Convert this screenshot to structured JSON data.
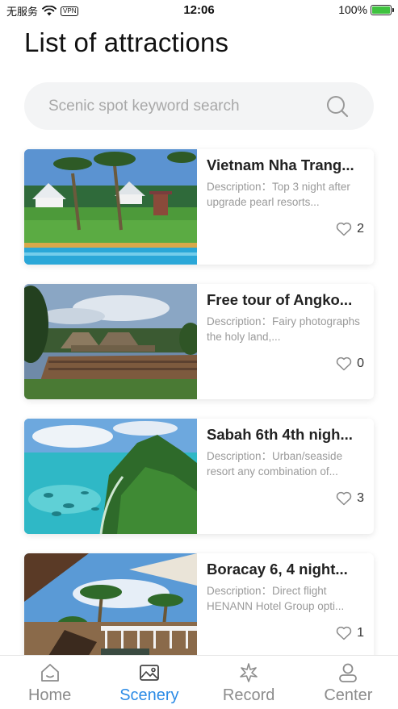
{
  "status_bar": {
    "carrier": "无服务",
    "vpn": "VPN",
    "time": "12:06",
    "battery": "100%",
    "battery_color": "#3fc23f"
  },
  "page": {
    "title": "List of attractions"
  },
  "search": {
    "placeholder": "Scenic spot keyword search",
    "icon": "search-icon"
  },
  "attractions": [
    {
      "title": "Vietnam Nha Trang...",
      "description": "Description：Top 3 night after upgrade pearl resorts...",
      "likes": "2",
      "image": "resort-garden-pool"
    },
    {
      "title": "Free tour of Angko...",
      "description": "Description：Fairy photographs the holy land,...",
      "likes": "0",
      "image": "angkor-temple"
    },
    {
      "title": "Sabah 6th 4th nigh...",
      "description": "Description：Urban/seaside resort any combination of...",
      "likes": "3",
      "image": "tropical-island-bay"
    },
    {
      "title": "Boracay 6, 4 night...",
      "description": "Description：Direct flight HENANN Hotel Group opti...",
      "likes": "1",
      "image": "beach-terrace-palms"
    }
  ],
  "tab_bar": {
    "accent_color": "#2b8be6",
    "inactive_color": "#8c8c8c",
    "tabs": [
      {
        "label": "Home",
        "icon": "home-icon",
        "active": false
      },
      {
        "label": "Scenery",
        "icon": "picture-icon",
        "active": true
      },
      {
        "label": "Record",
        "icon": "sparkle-icon",
        "active": false
      },
      {
        "label": "Center",
        "icon": "user-icon",
        "active": false
      }
    ]
  }
}
